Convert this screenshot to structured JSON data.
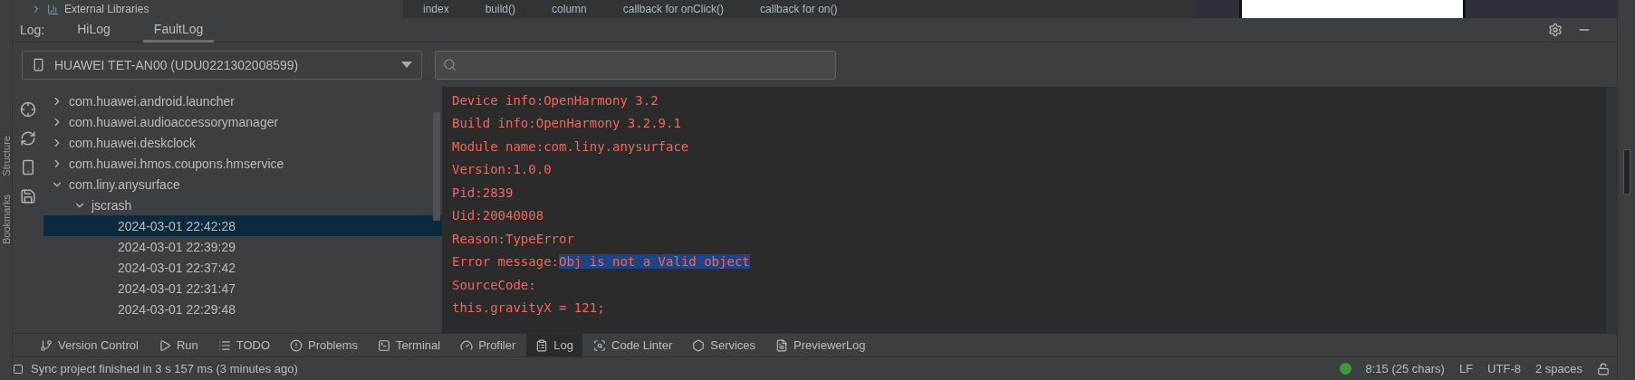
{
  "top_strip": {
    "project_item": "External Libraries",
    "breadcrumbs": [
      "index",
      "build()",
      "column",
      "callback for onClick()",
      "callback for on()"
    ]
  },
  "side_labels": [
    "Structure",
    "Bookmarks"
  ],
  "log_panel": {
    "label": "Log:",
    "tabs": [
      {
        "label": "HiLog",
        "selected": false
      },
      {
        "label": "FaultLog",
        "selected": true
      }
    ],
    "device_select": {
      "value": "HUAWEI TET-AN00 (UDU0221302008599)"
    }
  },
  "tree": [
    {
      "label": "com.huawei.android.launcher",
      "expanded": false,
      "selected": false
    },
    {
      "label": "com.huawei.audioaccessorymanager",
      "expanded": false,
      "selected": false
    },
    {
      "label": "com.huawei.deskclock",
      "expanded": false,
      "selected": false
    },
    {
      "label": "com.huawei.hmos.coupons.hmservice",
      "expanded": false,
      "selected": false
    },
    {
      "label": "com.liny.anysurface",
      "expanded": true,
      "selected": false,
      "children": [
        {
          "label": "jscrash",
          "expanded": true,
          "selected": false,
          "children": [
            {
              "label": "2024-03-01 22:42:28",
              "selected": true
            },
            {
              "label": "2024-03-01 22:39:29",
              "selected": false
            },
            {
              "label": "2024-03-01 22:37:42",
              "selected": false
            },
            {
              "label": "2024-03-01 22:31:47",
              "selected": false
            },
            {
              "label": "2024-03-01 22:29:48",
              "selected": false
            }
          ]
        }
      ]
    }
  ],
  "log_lines": [
    {
      "text": "Device info:OpenHarmony 3.2"
    },
    {
      "text": "Build info:OpenHarmony 3.2.9.1"
    },
    {
      "text": "Module name:com.liny.anysurface"
    },
    {
      "text": "Version:1.0.0"
    },
    {
      "text": "Pid:2839"
    },
    {
      "text": "Uid:20040008"
    },
    {
      "text": "Reason:TypeError"
    },
    {
      "text": "Error message:",
      "selection": "Obj is not a Valid object"
    },
    {
      "text": "SourceCode:"
    },
    {
      "text": "this.gravityX = 121;"
    }
  ],
  "tool_tabs": [
    {
      "kind": "vcs",
      "label": "Version Control",
      "selected": false
    },
    {
      "kind": "run",
      "label": "Run",
      "selected": false
    },
    {
      "kind": "todo",
      "label": "TODO",
      "selected": false
    },
    {
      "kind": "problems",
      "label": "Problems",
      "selected": false
    },
    {
      "kind": "terminal",
      "label": "Terminal",
      "selected": false
    },
    {
      "kind": "profiler",
      "label": "Profiler",
      "selected": false
    },
    {
      "kind": "log",
      "label": "Log",
      "selected": true
    },
    {
      "kind": "linter",
      "label": "Code Linter",
      "selected": false
    },
    {
      "kind": "services",
      "label": "Services",
      "selected": false
    },
    {
      "kind": "previewer",
      "label": "PreviewerLog",
      "selected": false
    }
  ],
  "status_bar": {
    "message": "Sync project finished in 3 s 157 ms (3 minutes ago)",
    "items": [
      "8:15 (25 chars)",
      "LF",
      "UTF-8",
      "2 spaces"
    ]
  }
}
